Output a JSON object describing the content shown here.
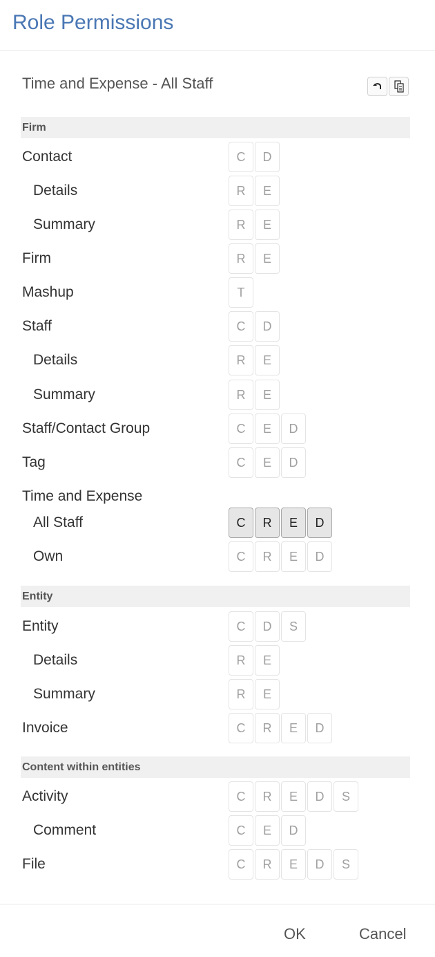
{
  "dialog": {
    "title": "Role Permissions",
    "subtitle": "Time and Expense - All Staff"
  },
  "toolbar": {
    "undo_icon": "undo-icon",
    "copy_icon": "copy-document-icon"
  },
  "sections": {
    "firm": "Firm",
    "entity": "Entity",
    "content": "Content within entities"
  },
  "rows": {
    "contact": {
      "label": "Contact",
      "perms": [
        "C",
        "D"
      ]
    },
    "contact_details": {
      "label": "Details",
      "perms": [
        "R",
        "E"
      ]
    },
    "contact_summary": {
      "label": "Summary",
      "perms": [
        "R",
        "E"
      ]
    },
    "firm": {
      "label": "Firm",
      "perms": [
        "R",
        "E"
      ]
    },
    "mashup": {
      "label": "Mashup",
      "perms": [
        "T"
      ]
    },
    "staff": {
      "label": "Staff",
      "perms": [
        "C",
        "D"
      ]
    },
    "staff_details": {
      "label": "Details",
      "perms": [
        "R",
        "E"
      ]
    },
    "staff_summary": {
      "label": "Summary",
      "perms": [
        "R",
        "E"
      ]
    },
    "staff_contact_group": {
      "label": "Staff/Contact Group",
      "perms": [
        "C",
        "E",
        "D"
      ]
    },
    "tag": {
      "label": "Tag",
      "perms": [
        "C",
        "E",
        "D"
      ]
    },
    "time_expense_group": {
      "label": "Time and Expense"
    },
    "te_all_staff": {
      "label": "All Staff",
      "perms": [
        "C",
        "R",
        "E",
        "D"
      ],
      "enabled": [
        true,
        true,
        true,
        true
      ]
    },
    "te_own": {
      "label": "Own",
      "perms": [
        "C",
        "R",
        "E",
        "D"
      ]
    },
    "entity": {
      "label": "Entity",
      "perms": [
        "C",
        "D",
        "S"
      ]
    },
    "entity_details": {
      "label": "Details",
      "perms": [
        "R",
        "E"
      ]
    },
    "entity_summary": {
      "label": "Summary",
      "perms": [
        "R",
        "E"
      ]
    },
    "invoice": {
      "label": "Invoice",
      "perms": [
        "C",
        "R",
        "E",
        "D"
      ]
    },
    "activity": {
      "label": "Activity",
      "perms": [
        "C",
        "R",
        "E",
        "D",
        "S"
      ]
    },
    "comment": {
      "label": "Comment",
      "perms": [
        "C",
        "E",
        "D"
      ]
    },
    "file": {
      "label": "File",
      "perms": [
        "C",
        "R",
        "E",
        "D",
        "S"
      ]
    }
  },
  "footer": {
    "ok_label": "OK",
    "cancel_label": "Cancel"
  }
}
